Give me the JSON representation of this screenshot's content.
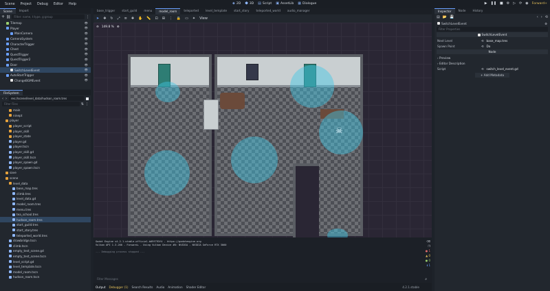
{
  "menu": [
    "Scene",
    "Project",
    "Debug",
    "Editor",
    "Help"
  ],
  "modes": [
    {
      "icon": "2D"
    },
    {
      "label": "2D"
    },
    {
      "label": "3D"
    },
    {
      "label": "Script"
    },
    {
      "label": "AssetLib"
    },
    {
      "label": "Dialogue"
    }
  ],
  "renderer": "Forward+",
  "scene_tabs": [
    "Scene",
    "Import"
  ],
  "filter_nodes_placeholder": "Filter: name, t:type, g:group",
  "scene_tree": [
    {
      "label": "Tilemap",
      "color": "#9ad06e",
      "indent": 1
    },
    {
      "label": "Player",
      "color": "#6aa0ff",
      "indent": 1
    },
    {
      "label": "MainCamera",
      "color": "#6aa0ff",
      "indent": 2
    },
    {
      "label": "CameraSystem",
      "color": "#6aa0ff",
      "indent": 1
    },
    {
      "label": "CharacterTrigger",
      "color": "#6aa0ff",
      "indent": 1
    },
    {
      "label": "Chest",
      "color": "#6aa0ff",
      "indent": 1
    },
    {
      "label": "QuestTrigger",
      "color": "#6aa0ff",
      "indent": 1
    },
    {
      "label": "QuestTrigger2",
      "color": "#6aa0ff",
      "indent": 1
    },
    {
      "label": "Door",
      "color": "#6aa0ff",
      "indent": 1
    },
    {
      "label": "SwitchLevelEvent",
      "color": "#e6e6e6",
      "indent": 2,
      "selected": true
    },
    {
      "label": "AutoStartTrigger",
      "color": "#6aa0ff",
      "indent": 1
    },
    {
      "label": "ChangeBGMEvent",
      "color": "#e6e6e6",
      "indent": 2
    }
  ],
  "filesystem_title": "FileSystem",
  "path": "res://scene/level_data/hudson_room.tres",
  "filter_files_placeholder": "Filter Files",
  "files": [
    {
      "label": "main",
      "indent": 2,
      "folder": true
    },
    {
      "label": "ninept",
      "indent": 2,
      "folder": true
    },
    {
      "label": "player",
      "indent": 1,
      "folder": true
    },
    {
      "label": "player_script",
      "indent": 2,
      "folder": true
    },
    {
      "label": "player_skill",
      "indent": 2,
      "folder": true
    },
    {
      "label": "player_state",
      "indent": 2,
      "folder": true
    },
    {
      "label": "player.gd",
      "indent": 2
    },
    {
      "label": "player.tscn",
      "indent": 2
    },
    {
      "label": "player_skill.gd",
      "indent": 2
    },
    {
      "label": "player_skill.tscn",
      "indent": 2
    },
    {
      "label": "player_spawn.gd",
      "indent": 2
    },
    {
      "label": "player_spawn.tscn",
      "indent": 2
    },
    {
      "label": "save",
      "indent": 1,
      "folder": true
    },
    {
      "label": "scene",
      "indent": 1,
      "folder": true
    },
    {
      "label": "level_data",
      "indent": 2,
      "folder": true
    },
    {
      "label": "base_map.tres",
      "indent": 3
    },
    {
      "label": "climb.tres",
      "indent": 3
    },
    {
      "label": "level_data.gd",
      "indent": 3
    },
    {
      "label": "model_room.tres",
      "indent": 3
    },
    {
      "label": "menu.tres",
      "indent": 3
    },
    {
      "label": "tea_school.tres",
      "indent": 3
    },
    {
      "label": "hudson_room.tres",
      "indent": 3,
      "selected": true
    },
    {
      "label": "start_guild.tres",
      "indent": 3
    },
    {
      "label": "start_story.tres",
      "indent": 3
    },
    {
      "label": "teleported_world.tres",
      "indent": 3
    },
    {
      "label": "drawbridge.tscn",
      "indent": 2
    },
    {
      "label": "climb.tscn",
      "indent": 2
    },
    {
      "label": "empty_test_scene.gd",
      "indent": 2
    },
    {
      "label": "empty_test_scene.tscn",
      "indent": 2
    },
    {
      "label": "level_script.gd",
      "indent": 2
    },
    {
      "label": "level_template.tscn",
      "indent": 2
    },
    {
      "label": "model_room.tscn",
      "indent": 2
    },
    {
      "label": "hudson_room.tscn",
      "indent": 2
    }
  ],
  "editor_tabs": [
    "base_trigger",
    "start_guild",
    "menu",
    "model_room",
    "teleported",
    "level_template",
    "start_story",
    "teleported_world",
    "audio_manager"
  ],
  "active_editor_tab": "model_room",
  "zoom": "149.8 %",
  "view_label": "View",
  "console_lines": [
    "Godot Engine v4.2.1.stable.official.b09f793f4 - https://godotengine.org",
    "Vulkan API 1.3.260 - Forward+ - Using Vulkan Device #0: NVIDIA - NVIDIA GeForce RTX 3060",
    "--- Debugging process stopped ---"
  ],
  "filter_messages_placeholder": "Filter Messages",
  "bottom_tabs": [
    "Output",
    "Debugger (1)",
    "Search Results",
    "Audio",
    "Animation",
    "Shader Editor"
  ],
  "version": "4.2.1.stable",
  "inspector_tabs": [
    "Inspector",
    "Node",
    "History"
  ],
  "inspector_node": "SwitchLevelEvent",
  "filter_properties_placeholder": "Filter Properties",
  "inspector_class": "SwitchLevelEvent",
  "props": [
    {
      "label": "Next Level",
      "value": "base_map.tres"
    },
    {
      "label": "Spawn Point",
      "value": "Do"
    }
  ],
  "node_section": "Node",
  "preview_label": "Preview",
  "editor_desc_label": "Editor Description",
  "script_label": "Script",
  "script_value": "switch_level_event.gd",
  "add_metadata": "Add Metadata",
  "console_counts": [
    "1",
    "0",
    "0",
    "1"
  ],
  "accent": "#6aa0ff"
}
